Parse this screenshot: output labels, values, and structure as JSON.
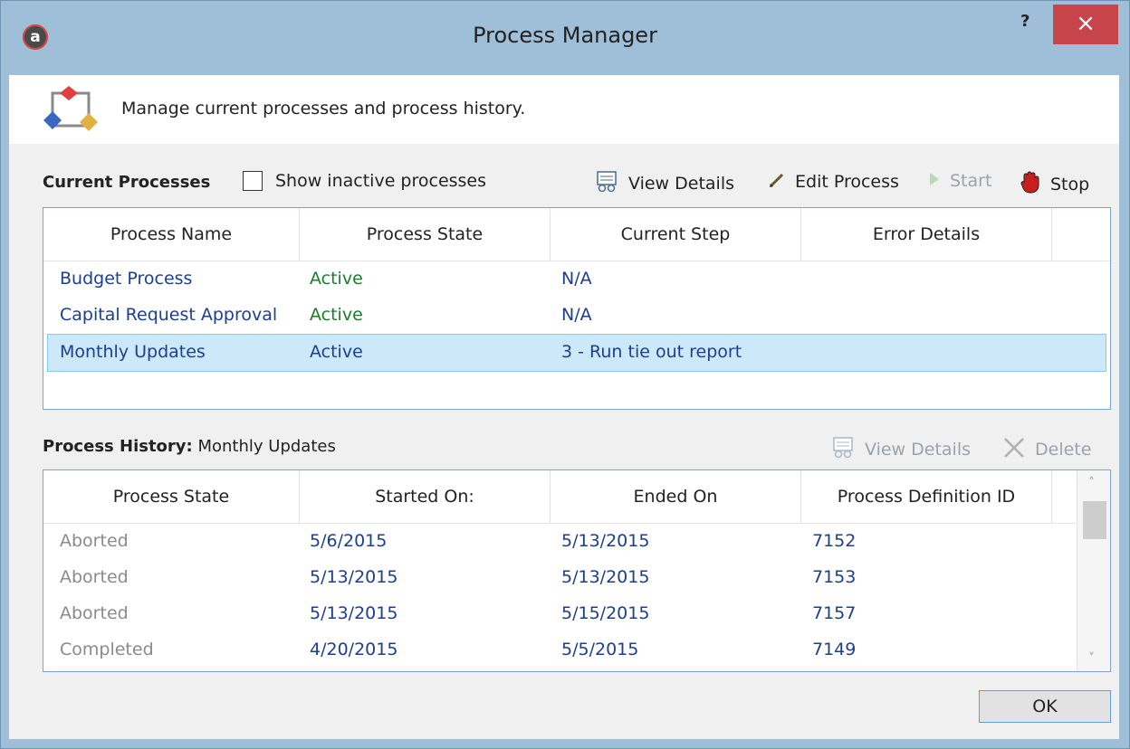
{
  "window": {
    "title": "Process Manager",
    "app_icon_letter": "a",
    "help_label": "?",
    "close_label": "×"
  },
  "header": {
    "description": "Manage current processes and process history."
  },
  "current": {
    "label": "Current Processes",
    "show_inactive_label": "Show inactive processes",
    "toolbar": {
      "view_details": "View Details",
      "edit_process": "Edit Process",
      "start": "Start",
      "stop": "Stop"
    },
    "columns": [
      "Process Name",
      "Process State",
      "Current Step",
      "Error Details"
    ],
    "rows": [
      {
        "name": "Budget Process",
        "state": "Active",
        "step": "N/A",
        "error": ""
      },
      {
        "name": "Capital Request Approval",
        "state": "Active",
        "step": "N/A",
        "error": ""
      },
      {
        "name": "Monthly Updates",
        "state": "Active",
        "step": "3 - Run tie out report",
        "error": ""
      }
    ]
  },
  "history": {
    "label": "Process History:",
    "selected_process": "Monthly Updates",
    "toolbar": {
      "view_details": "View Details",
      "delete": "Delete"
    },
    "columns": [
      "Process State",
      "Started On:",
      "Ended On",
      "Process Definition ID"
    ],
    "rows": [
      {
        "state": "Aborted",
        "started": "5/6/2015",
        "ended": "5/13/2015",
        "id": "7152"
      },
      {
        "state": "Aborted",
        "started": "5/13/2015",
        "ended": "5/13/2015",
        "id": "7153"
      },
      {
        "state": "Aborted",
        "started": "5/13/2015",
        "ended": "5/15/2015",
        "id": "7157"
      },
      {
        "state": "Completed",
        "started": "4/20/2015",
        "ended": "5/5/2015",
        "id": "7149"
      }
    ]
  },
  "ok_label": "OK",
  "colors": {
    "frame": "#9fbfd8",
    "close_button": "#c9454c",
    "selection": "#cde8f8",
    "active_state": "#1c7d2b",
    "link": "#1c3f8f"
  }
}
